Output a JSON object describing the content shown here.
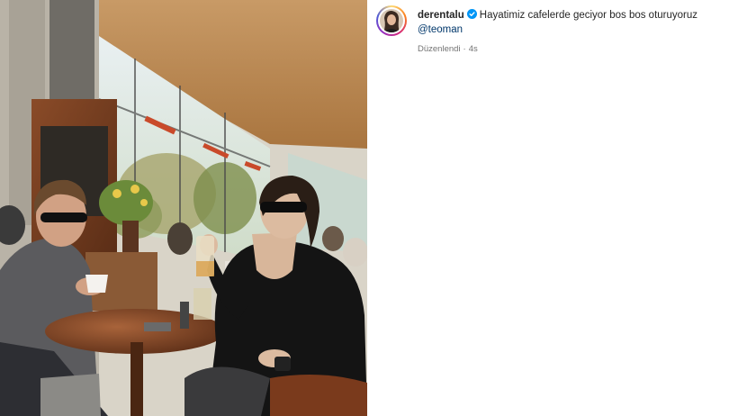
{
  "post": {
    "author": {
      "username": "derentalu",
      "verified": true,
      "avatar_icon": "profile-avatar"
    },
    "caption": {
      "text": "Hayatimiz cafelerde geciyor bos bos oturuyoruz",
      "mention": "@teoman"
    },
    "meta": {
      "edited_label": "Düzenlendi",
      "separator": "·",
      "time_ago": "4s"
    },
    "colors": {
      "verified_badge": "#0095f6",
      "mention_link": "#00376b",
      "secondary_text": "#737373"
    },
    "photo": {
      "description_icon": "cafe-photo"
    }
  }
}
